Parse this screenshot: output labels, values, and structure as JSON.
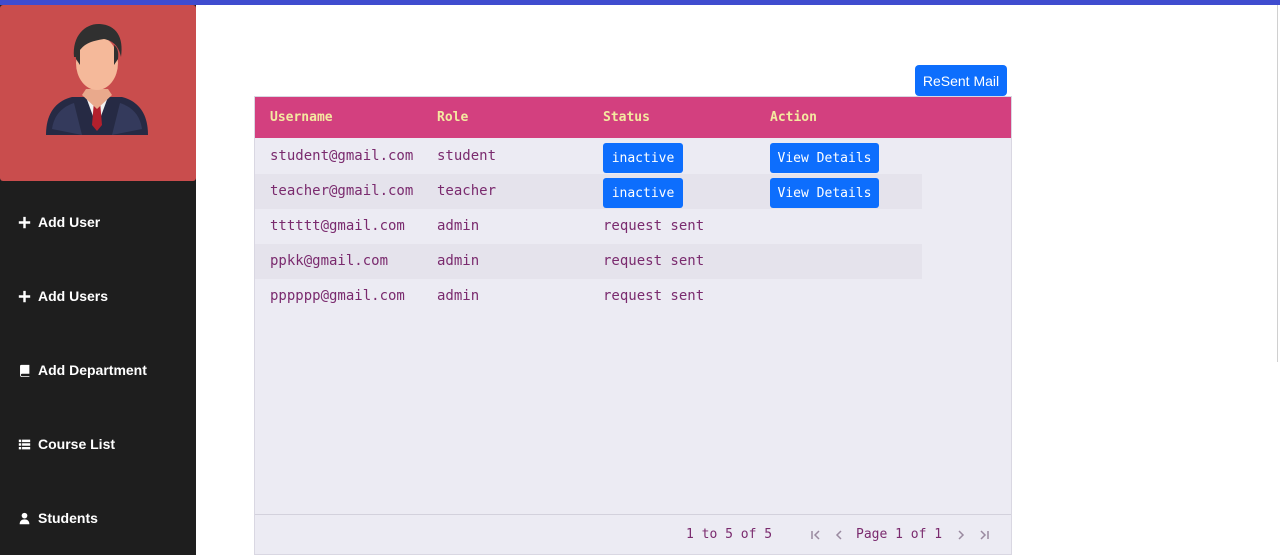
{
  "sidebar": {
    "items": [
      {
        "label": "Add User",
        "icon": "plus-icon"
      },
      {
        "label": "Add Users",
        "icon": "plus-icon"
      },
      {
        "label": "Add Department",
        "icon": "book-icon"
      },
      {
        "label": "Course List",
        "icon": "list-icon"
      },
      {
        "label": "Students",
        "icon": "user-icon"
      }
    ]
  },
  "toolbar": {
    "resend_label": "ReSent Mail"
  },
  "table": {
    "columns": [
      "Username",
      "Role",
      "Status",
      "Action"
    ],
    "rows": [
      {
        "username": "student@gmail.com",
        "role": "student",
        "status": "inactive",
        "action": "View Details"
      },
      {
        "username": "teacher@gmail.com",
        "role": "teacher",
        "status": "inactive",
        "action": "View Details"
      },
      {
        "username": "tttttt@gmail.com",
        "role": "admin",
        "status": "request sent",
        "action": ""
      },
      {
        "username": "ppkk@gmail.com",
        "role": "admin",
        "status": "request sent",
        "action": ""
      },
      {
        "username": "pppppp@gmail.com",
        "role": "admin",
        "status": "request sent",
        "action": ""
      }
    ]
  },
  "pagination": {
    "summary": "1 to 5 of 5",
    "page_text": "Page 1 of 1"
  },
  "colors": {
    "accent": "#0d6efd",
    "header": "#d3407f",
    "sidebar": "#1e1e1e",
    "avatar_panel": "#c94d4d",
    "top_bar": "#3f4ccf"
  }
}
